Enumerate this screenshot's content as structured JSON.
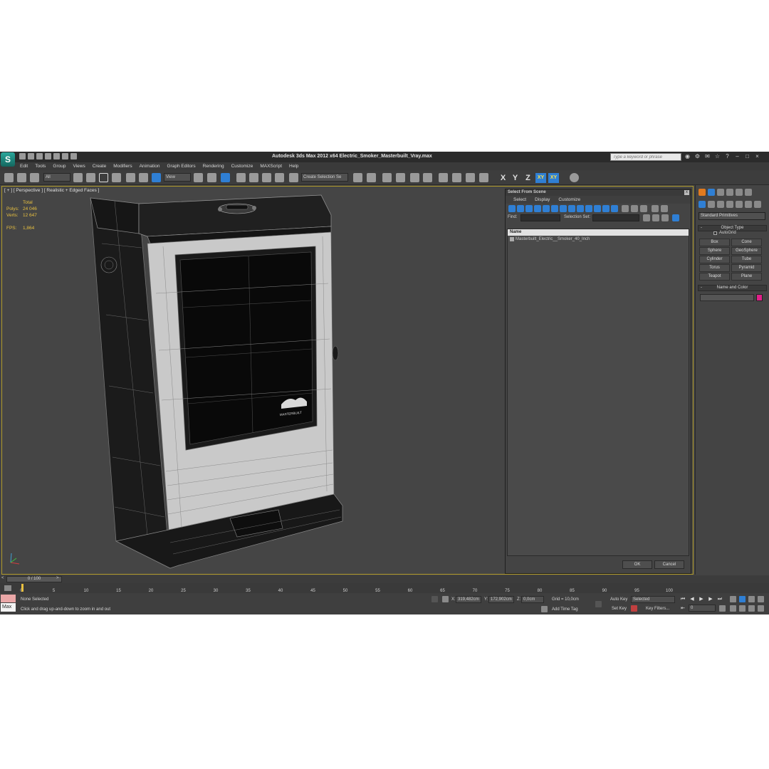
{
  "app": {
    "window_title": "Autodesk 3ds Max  2012 x64     Electric_Smoker_Masterbuilt_Vray.max",
    "search_placeholder": "Type a keyword or phrase"
  },
  "menu": [
    "Edit",
    "Tools",
    "Group",
    "Views",
    "Create",
    "Modifiers",
    "Animation",
    "Graph Editors",
    "Rendering",
    "Customize",
    "MAXScript",
    "Help"
  ],
  "toolbar": {
    "selection_filter": "All",
    "reference_coord": "View",
    "selection_set": "Create Selection Se",
    "axes": [
      "X",
      "Y",
      "Z",
      "XY",
      "XY"
    ]
  },
  "viewport": {
    "label": "[ + ] [ Perspective ] [ Realistic + Edged Faces ]",
    "stats": {
      "total_label": "Total",
      "polys_label": "Polys:",
      "polys_value": "24 046",
      "verts_label": "Verts:",
      "verts_value": "12 647",
      "fps_label": "FPS:",
      "fps_value": "1,864"
    },
    "logo_text": "MASTERBUILT"
  },
  "dialog": {
    "title": "Select From Scene",
    "close": "x",
    "menu": [
      "Select",
      "Display",
      "Customize"
    ],
    "find_label": "Find:",
    "selection_set_label": "Selection Set:",
    "list_header": "Name",
    "items": [
      "Masterbuilt_Electric__Smoker_40_Inch"
    ],
    "ok": "OK",
    "cancel": "Cancel"
  },
  "command_panel": {
    "dropdown": "Standard Primitives",
    "object_type_title": "Object Type",
    "rollout_minus": "-",
    "autogrid": "AutoGrid",
    "buttons": [
      "Box",
      "Cone",
      "Sphere",
      "GeoSphere",
      "Cylinder",
      "Tube",
      "Torus",
      "Pyramid",
      "Teapot",
      "Plane"
    ],
    "name_color_title": "Name and Color",
    "color": "#e0208a"
  },
  "timeline": {
    "slider_label": "0 / 100",
    "prev": "<",
    "next": ">",
    "ticks": [
      "0",
      "5",
      "10",
      "15",
      "20",
      "25",
      "30",
      "35",
      "40",
      "45",
      "50",
      "55",
      "60",
      "65",
      "70",
      "75",
      "80",
      "85",
      "90",
      "95",
      "100"
    ]
  },
  "status": {
    "maxscript_label": "Max",
    "selection": "None Selected",
    "prompt": "Click and drag up-and-down to zoom in and out",
    "x_label": "X:",
    "x_value": "319,482cm",
    "y_label": "Y:",
    "y_value": "172,902cm",
    "z_label": "Z:",
    "z_value": "0,0cm",
    "grid": "Grid = 10,0cm",
    "add_time_tag": "Add Time Tag",
    "auto_key": "Auto Key",
    "set_key": "Set Key",
    "key_mode": "Selected",
    "key_filters": "Key Filters...",
    "frame": "0"
  }
}
